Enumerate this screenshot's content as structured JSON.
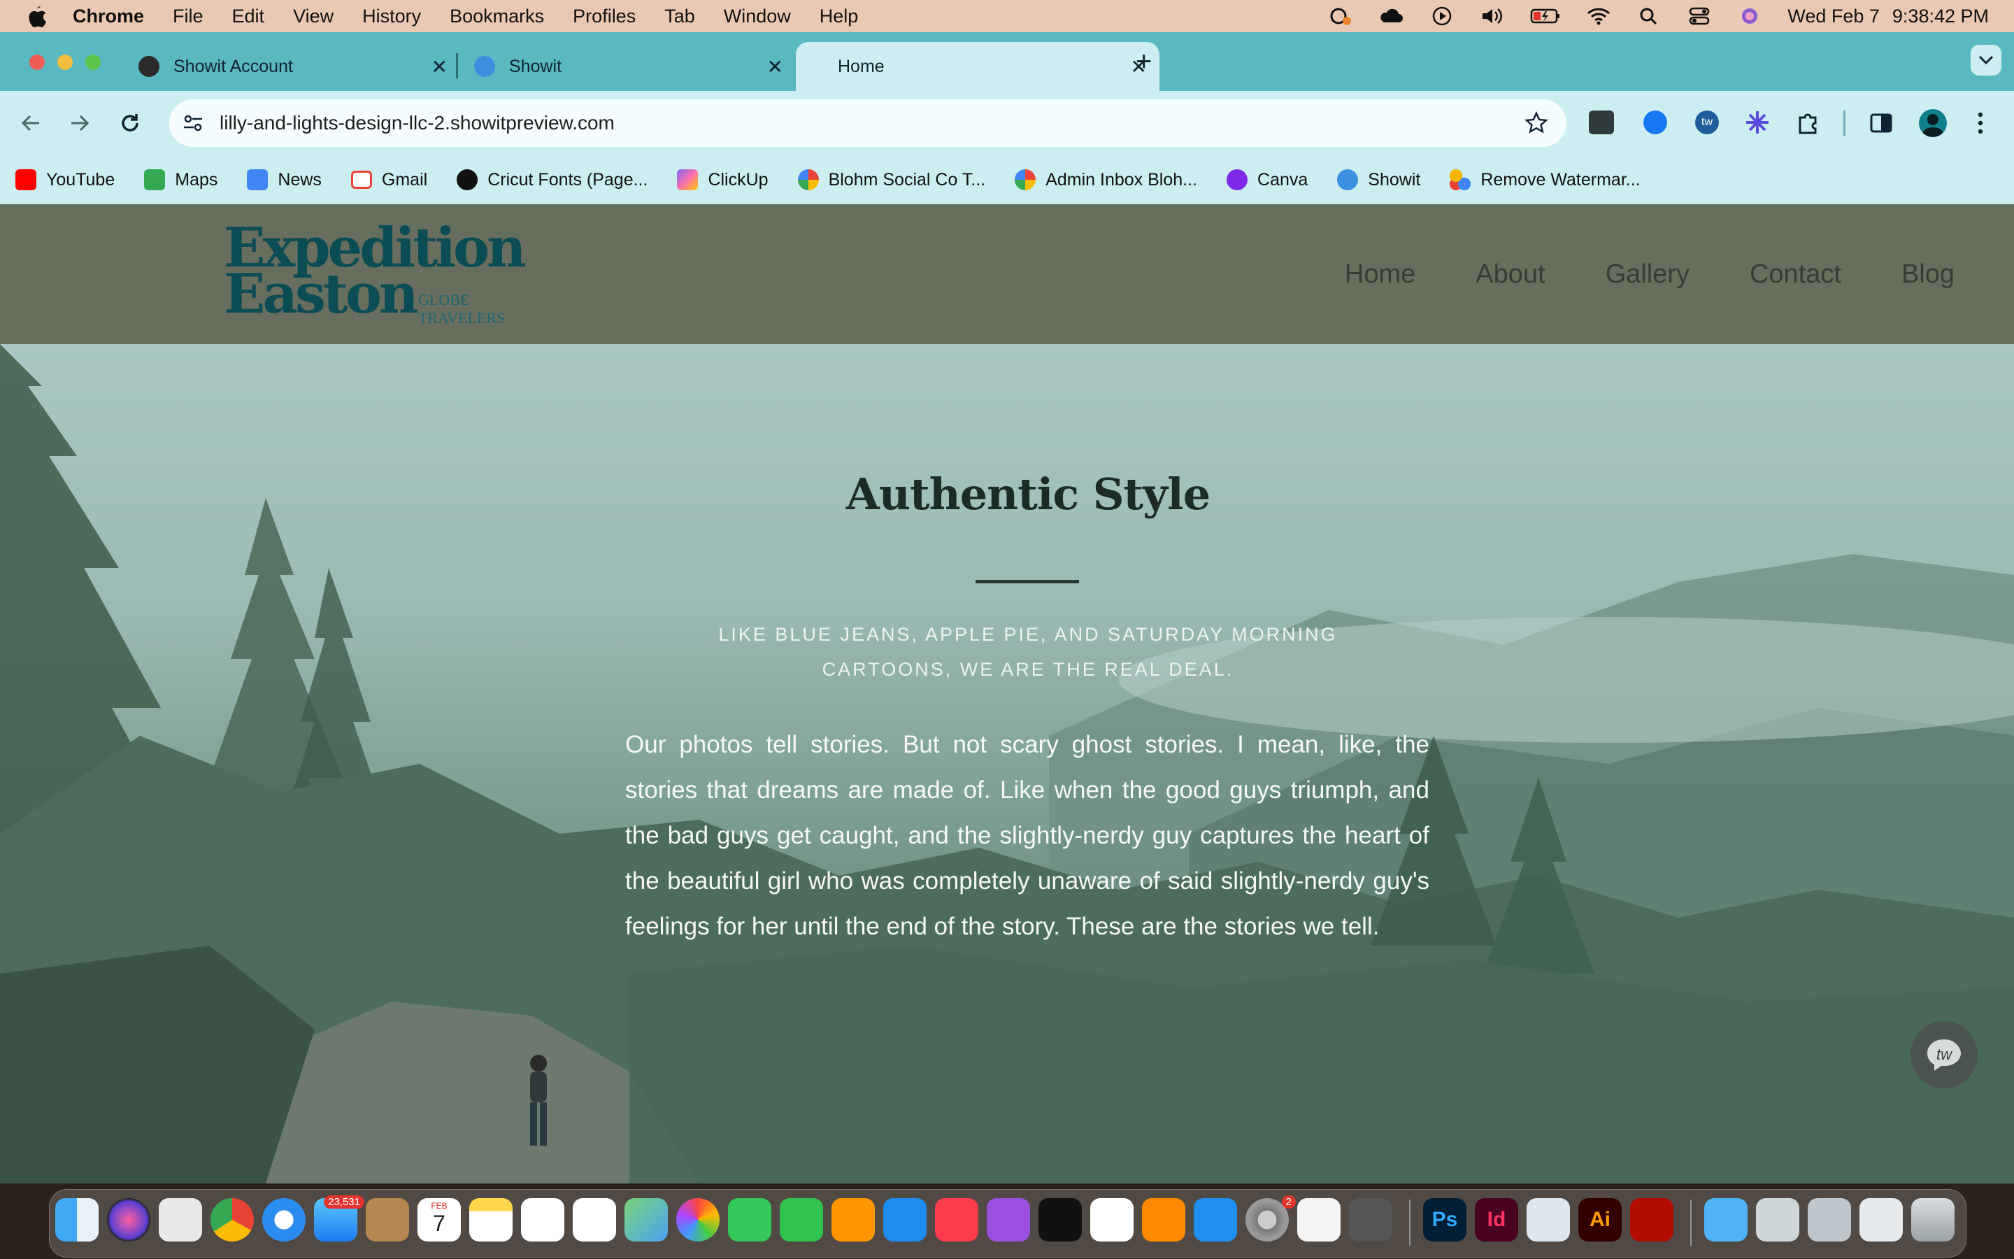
{
  "menubar": {
    "items": [
      "Chrome",
      "File",
      "Edit",
      "View",
      "History",
      "Bookmarks",
      "Profiles",
      "Tab",
      "Window",
      "Help"
    ],
    "date": "Wed Feb 7",
    "time": "9:38:42 PM"
  },
  "browser": {
    "tabs": [
      {
        "title": "Showit Account"
      },
      {
        "title": "Showit"
      },
      {
        "title": "Home"
      }
    ],
    "url": "lilly-and-lights-design-llc-2.showitpreview.com",
    "bookmarks": [
      "YouTube",
      "Maps",
      "News",
      "Gmail",
      "Cricut Fonts (Page...",
      "ClickUp",
      "Blohm Social Co T...",
      "Admin Inbox Bloh...",
      "Canva",
      "Showit",
      "Remove Watermar..."
    ]
  },
  "site": {
    "logo": {
      "line1": "Expedition",
      "line2": "Easton",
      "tagline": "GLOBE TRAVELERS"
    },
    "nav": [
      "Home",
      "About",
      "Gallery",
      "Contact",
      "Blog"
    ],
    "hero": {
      "title": "Authentic Style",
      "subtitle": "LIKE BLUE JEANS, APPLE PIE, AND SATURDAY MORNING CARTOONS, WE ARE THE REAL DEAL.",
      "body": "Our photos tell stories. But not scary ghost stories. I mean, like, the stories that dreams are made of. Like when the good guys triumph, and the bad guys get caught, and the slightly-nerdy guy captures the heart of the beautiful girl who was completely unaware of said slightly-nerdy guy's feelings for her until the end of the story. These are the stories we tell."
    },
    "chat_widget": {
      "label": "tw"
    }
  },
  "dock": {
    "apps": [
      "Finder",
      "Siri",
      "Launchpad",
      "Chrome",
      "Safari",
      "Mail",
      "Contacts",
      "Calendar",
      "Notes",
      "Freeform",
      "Reminders",
      "Maps",
      "Photos",
      "Messages",
      "FaceTime",
      "Pages",
      "Keynote",
      "Music",
      "Podcasts",
      "TV",
      "News",
      "Books",
      "App Store",
      "System Settings",
      "TextEdit",
      "Screenshot",
      "Photoshop",
      "InDesign",
      "Preview",
      "Illustrator",
      "Acrobat",
      "Downloads",
      "Stack 1",
      "Stack 2",
      "Stack 3",
      "Trash"
    ],
    "mail_badge": "23,531",
    "settings_badge": "2",
    "calendar_month": "FEB",
    "calendar_day": "7"
  },
  "colors": {
    "menubar": "#e9c9b3",
    "tabstrip": "#5ab8c0",
    "toolbar": "#cdeef0",
    "site_header": "#676e5d",
    "logo": "#0c4c55"
  }
}
